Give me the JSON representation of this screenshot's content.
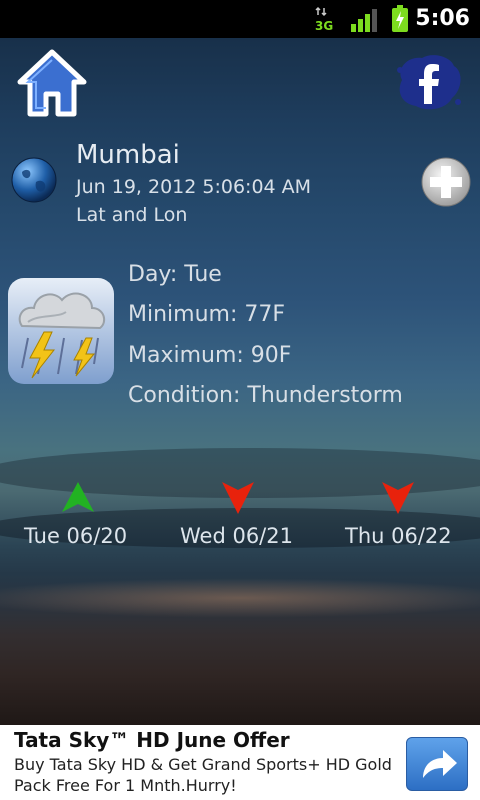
{
  "status_bar": {
    "time": "5:06",
    "network": "3G"
  },
  "location": {
    "city": "Mumbai",
    "datetime": "Jun 19, 2012 5:06:04 AM",
    "latlon": "Lat and Lon"
  },
  "weather": {
    "day": "Day: Tue",
    "minimum": "Minimum: 77F",
    "maximum": "Maximum: 90F",
    "condition": "Condition: Thunderstorm"
  },
  "forecast": [
    {
      "date": "Tue 06/20",
      "trend": "up",
      "color": "#22b222"
    },
    {
      "date": "Wed 06/21",
      "trend": "down",
      "color": "#e8220c"
    },
    {
      "date": "Thu 06/22",
      "trend": "down",
      "color": "#e8220c"
    }
  ],
  "ad": {
    "title": "Tata Sky™ HD June Offer",
    "text": "Buy Tata Sky HD & Get Grand Sports+ HD Gold Pack Free For 1 Mnth.Hurry!"
  },
  "icons": {
    "home": "home-icon",
    "facebook": "facebook-icon",
    "globe": "globe-icon",
    "add": "plus-icon",
    "weather": "thunderstorm-icon",
    "ad_action": "share-arrow-icon"
  }
}
